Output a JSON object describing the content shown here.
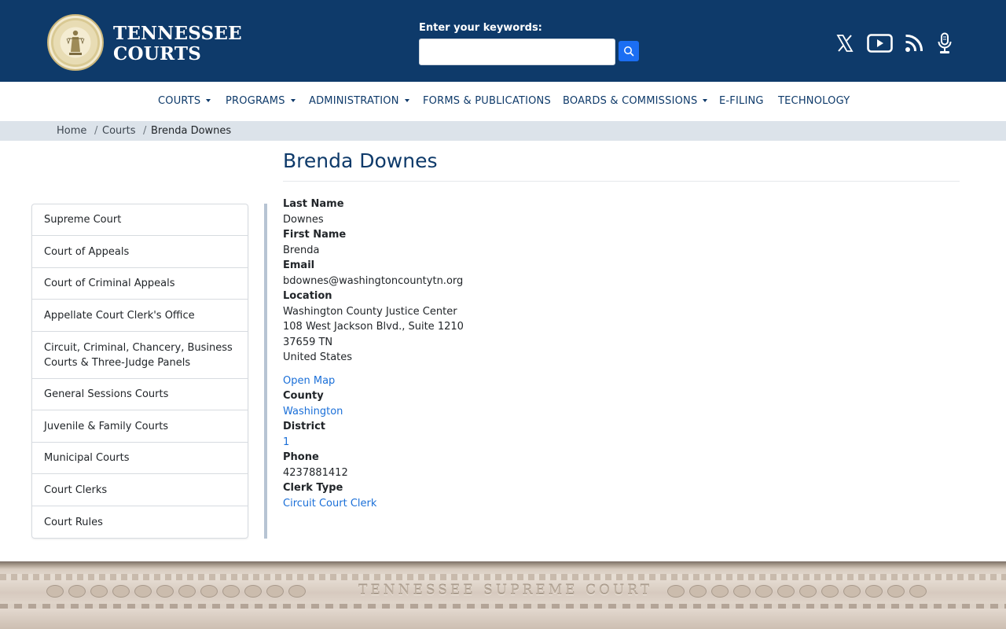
{
  "header": {
    "brand_line1": "TENNESSEE",
    "brand_line2": "COURTS",
    "search_label": "Enter your keywords:",
    "search_value": "",
    "social": [
      "x-icon",
      "youtube-icon",
      "rss-icon",
      "podcast-icon"
    ],
    "colors": {
      "header_bg": "#0e3a6a",
      "search_button": "#1b6ef3"
    }
  },
  "nav": {
    "items": [
      {
        "label": "COURTS",
        "dropdown": true
      },
      {
        "label": "PROGRAMS",
        "dropdown": true
      },
      {
        "label": "ADMINISTRATION",
        "dropdown": true
      },
      {
        "label": "FORMS & PUBLICATIONS",
        "dropdown": false
      },
      {
        "label": "BOARDS & COMMISSIONS",
        "dropdown": true
      },
      {
        "label": "E-FILING",
        "dropdown": false
      },
      {
        "label": "TECHNOLOGY",
        "dropdown": false
      }
    ]
  },
  "breadcrumb": {
    "home": "Home",
    "courts": "Courts",
    "current": "Brenda Downes"
  },
  "page": {
    "title": "Brenda Downes"
  },
  "sidebar": {
    "items": [
      "Supreme Court",
      "Court of Appeals",
      "Court of Criminal Appeals",
      "Appellate Court Clerk's Office",
      "Circuit, Criminal, Chancery, Business Courts & Three-Judge Panels",
      "General Sessions Courts",
      "Juvenile & Family Courts",
      "Municipal Courts",
      "Court Clerks",
      "Court Rules"
    ]
  },
  "details": {
    "last_name_label": "Last Name",
    "last_name": "Downes",
    "first_name_label": "First Name",
    "first_name": "Brenda",
    "email_label": "Email",
    "email": "bdownes@washingtoncountytn.org",
    "location_label": "Location",
    "location_line1": "Washington County Justice Center",
    "location_line2": "108 West Jackson Blvd., Suite 1210",
    "location_line3": "37659 TN",
    "location_line4": "United States",
    "open_map": "Open Map",
    "county_label": "County",
    "county": "Washington",
    "district_label": "District",
    "district": "1",
    "phone_label": "Phone",
    "phone": "4237881412",
    "clerk_type_label": "Clerk Type",
    "clerk_type": "Circuit Court Clerk"
  },
  "footer": {
    "building_inscription": "TENNESSEE SUPREME COURT"
  }
}
